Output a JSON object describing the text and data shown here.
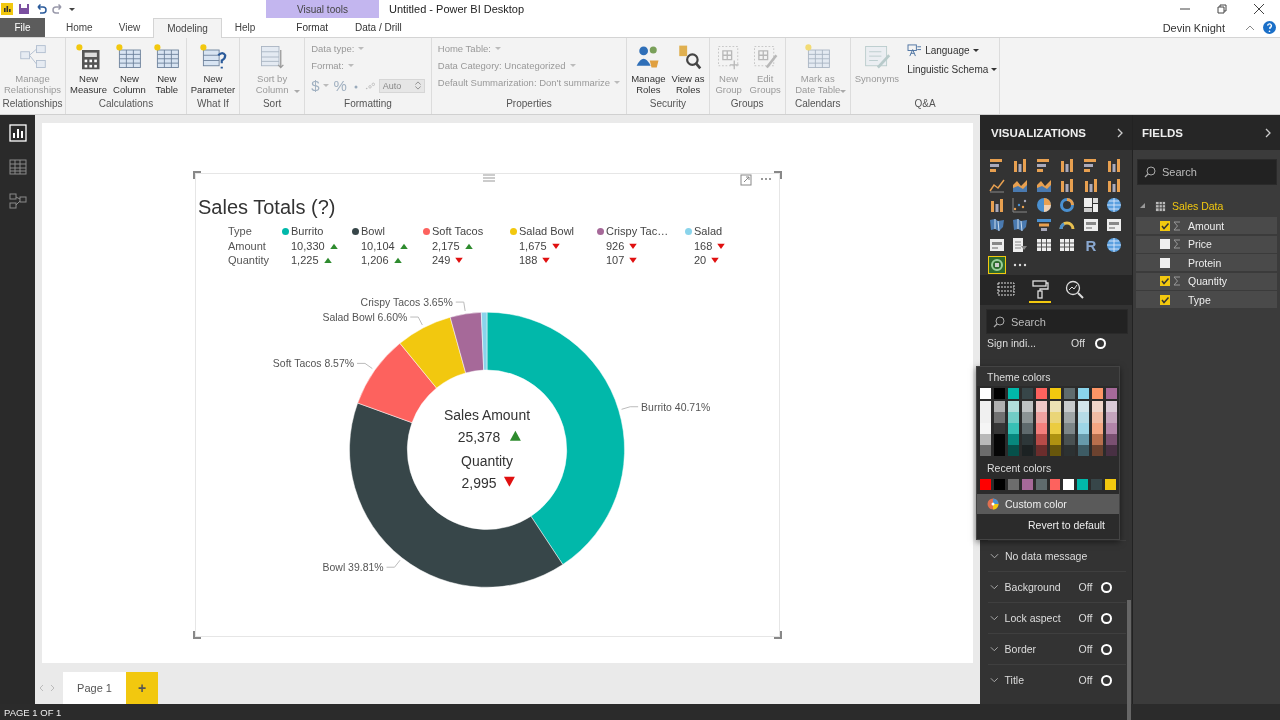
{
  "title_bar": {
    "title": "Untitled - Power BI Desktop",
    "context_label": "Visual tools"
  },
  "menu_tabs": [
    {
      "label": "File",
      "kind": "file",
      "selected": false
    },
    {
      "label": "Home",
      "kind": "main",
      "selected": false
    },
    {
      "label": "View",
      "kind": "main",
      "selected": false
    },
    {
      "label": "Modeling",
      "kind": "main",
      "selected": true
    },
    {
      "label": "Help",
      "kind": "main",
      "selected": false
    },
    {
      "label": "Format",
      "kind": "context",
      "selected": false
    },
    {
      "label": "Data / Drill",
      "kind": "context",
      "selected": false
    }
  ],
  "user": "Devin Knight",
  "ribbon": [
    {
      "label": "Relationships",
      "kind": "buttons",
      "buttons": [
        {
          "kind": "relationships",
          "label": "Manage\nRelationships",
          "disabled": true,
          "dropdown": false
        }
      ]
    },
    {
      "label": "Calculations",
      "kind": "buttons",
      "buttons": [
        {
          "kind": "calculator",
          "label": "New\nMeasure",
          "disabled": false,
          "dropdown": false
        },
        {
          "kind": "new-table",
          "label": "New\nColumn",
          "disabled": false,
          "dropdown": false
        },
        {
          "kind": "new-table",
          "label": "New\nTable",
          "disabled": false,
          "dropdown": false
        }
      ]
    },
    {
      "label": "What If",
      "kind": "buttons",
      "buttons": [
        {
          "kind": "parameter",
          "label": "New\nParameter",
          "disabled": false,
          "dropdown": false
        }
      ]
    },
    {
      "label": "Sort",
      "kind": "buttons",
      "buttons": [
        {
          "kind": "sort",
          "label": "Sort by\nColumn",
          "disabled": true,
          "dropdown": true
        }
      ]
    },
    {
      "label": "Formatting",
      "kind": "formatting",
      "fields": [
        {
          "label": "Data type:",
          "disabled": true
        },
        {
          "label": "Format:",
          "disabled": true
        }
      ],
      "currency": "$",
      "percent": "%",
      "decimals": "Auto",
      "disabled": true
    },
    {
      "label": "Properties",
      "kind": "properties",
      "fields": [
        {
          "label": "Home Table:",
          "disabled": true
        },
        {
          "label": "Data Category: Uncategorized",
          "disabled": true
        },
        {
          "label": "Default Summarization: Don't summarize",
          "disabled": true
        }
      ]
    },
    {
      "label": "Security",
      "kind": "buttons",
      "buttons": [
        {
          "kind": "roles",
          "label": "Manage\nRoles",
          "disabled": false,
          "dropdown": false
        },
        {
          "kind": "view-roles",
          "label": "View as\nRoles",
          "disabled": false,
          "dropdown": false
        }
      ]
    },
    {
      "label": "Groups",
      "kind": "buttons",
      "buttons": [
        {
          "kind": "new-group",
          "label": "New\nGroup",
          "disabled": true,
          "dropdown": false
        },
        {
          "kind": "edit-group",
          "label": "Edit\nGroups",
          "disabled": true,
          "dropdown": false
        }
      ]
    },
    {
      "label": "Calendars",
      "kind": "buttons",
      "buttons": [
        {
          "kind": "date-table",
          "label": "Mark as\nDate Table",
          "disabled": true,
          "dropdown": true
        }
      ]
    },
    {
      "label": "Q&A",
      "kind": "qa",
      "buttons": [
        {
          "kind": "synonyms",
          "label": "Synonyms",
          "disabled": true,
          "dropdown": false
        }
      ],
      "menus": [
        {
          "label": "Language",
          "kind": "language"
        },
        {
          "label": "Linguistic Schema",
          "kind": "plain"
        }
      ]
    }
  ],
  "views": [
    {
      "kind": "report",
      "selected": true
    },
    {
      "kind": "data",
      "selected": false
    },
    {
      "kind": "model",
      "selected": false
    }
  ],
  "visual": {
    "title": "Sales Totals (?)",
    "row_labels": [
      "Type",
      "Amount",
      "Quantity"
    ],
    "legend": [
      {
        "name": "Burrito",
        "color": "#01b8aa",
        "amount": "10,330",
        "amount_up": true,
        "quantity": "1,225",
        "quantity_up": true
      },
      {
        "name": "Bowl",
        "color": "#374649",
        "amount": "10,104",
        "amount_up": true,
        "quantity": "1,206",
        "quantity_up": true
      },
      {
        "name": "Soft Tacos",
        "color": "#fd625e",
        "amount": "2,175",
        "amount_up": true,
        "quantity": "249",
        "quantity_up": false
      },
      {
        "name": "Salad Bowl",
        "color": "#f2c80f",
        "amount": "1,675",
        "amount_up": false,
        "quantity": "188",
        "quantity_up": false
      },
      {
        "name": "Crispy Tac…",
        "color": "#a66999",
        "amount": "926",
        "amount_up": false,
        "quantity": "107",
        "quantity_up": false
      },
      {
        "name": "Salad",
        "color": "#8ad4eb",
        "amount": "168",
        "amount_up": false,
        "quantity": "20",
        "quantity_up": false
      }
    ],
    "center": {
      "label_1": "Sales Amount",
      "value_1": "25,378",
      "up_1": true,
      "label_2": "Quantity",
      "value_2": "2,995",
      "up_2": false
    },
    "chart_data": {
      "type": "donut",
      "values": [
        40.71,
        39.81,
        8.57,
        6.6,
        3.65,
        0.66
      ],
      "value_labels": [
        "Burrito 40.71%",
        "Bowl 39.81%",
        "Soft Tacos 8.57%",
        "Salad Bowl 6.60%",
        "Crispy Tacos 3.65%",
        null
      ]
    }
  },
  "pages": [
    {
      "label": "Page 1",
      "selected": true
    }
  ],
  "add_page": "+",
  "status": "PAGE 1 OF 1",
  "visualizations": {
    "title": "VISUALIZATIONS",
    "types": [
      {
        "kind": "hbar",
        "selected": false
      },
      {
        "kind": "vbar",
        "selected": false
      },
      {
        "kind": "hbar",
        "selected": false
      },
      {
        "kind": "vbar",
        "selected": false
      },
      {
        "kind": "hbar",
        "selected": false
      },
      {
        "kind": "vbar",
        "selected": false
      },
      {
        "kind": "line",
        "selected": false
      },
      {
        "kind": "area",
        "selected": false
      },
      {
        "kind": "area",
        "selected": false
      },
      {
        "kind": "vbar",
        "selected": false
      },
      {
        "kind": "vbar",
        "selected": false
      },
      {
        "kind": "vbar",
        "selected": false
      },
      {
        "kind": "vbar",
        "selected": false
      },
      {
        "kind": "scatter",
        "selected": false
      },
      {
        "kind": "pie",
        "selected": false
      },
      {
        "kind": "donut",
        "selected": false
      },
      {
        "kind": "treemap",
        "selected": false
      },
      {
        "kind": "globe",
        "selected": false
      },
      {
        "kind": "map",
        "selected": false
      },
      {
        "kind": "map",
        "selected": false
      },
      {
        "kind": "funnel",
        "selected": false
      },
      {
        "kind": "gauge",
        "selected": false
      },
      {
        "kind": "card",
        "selected": false
      },
      {
        "kind": "card",
        "selected": false
      },
      {
        "kind": "card",
        "selected": false
      },
      {
        "kind": "slicer",
        "selected": false
      },
      {
        "kind": "table",
        "selected": false
      },
      {
        "kind": "table",
        "selected": false
      },
      {
        "kind": "glyph",
        "glyph": "R",
        "selected": false
      },
      {
        "kind": "globe",
        "selected": false
      },
      {
        "kind": "custom",
        "selected": true
      },
      {
        "kind": "more",
        "selected": false
      }
    ],
    "pane_tabs": [
      {
        "kind": "fields",
        "selected": false
      },
      {
        "kind": "format",
        "selected": true
      },
      {
        "kind": "analytics",
        "selected": false
      }
    ],
    "search": {
      "placeholder": "Search"
    },
    "sign_indicator": {
      "label": "Sign indi...",
      "state": "Off",
      "on": false
    },
    "color_picker": {
      "theme_title": "Theme colors",
      "theme_colors": [
        {
          "color": "#ffffff"
        },
        {
          "color": "#000000"
        },
        {
          "color": "#01b8aa"
        },
        {
          "color": "#374649"
        },
        {
          "color": "#fd625e"
        },
        {
          "color": "#f2c80f"
        },
        {
          "color": "#5f6b6d"
        },
        {
          "color": "#8ad4eb"
        },
        {
          "color": "#fe9666"
        },
        {
          "color": "#a66999"
        }
      ],
      "recent_title": "Recent colors",
      "recent_colors": [
        {
          "color": "#ff0000"
        },
        {
          "color": "#000000"
        },
        {
          "color": "#6d6d6d"
        },
        {
          "color": "#a66999"
        },
        {
          "color": "#5f6b6d"
        },
        {
          "color": "#fd625e"
        },
        {
          "color": "#ffffff"
        },
        {
          "color": "#01b8aa"
        },
        {
          "color": "#374649"
        },
        {
          "color": "#f2c80f"
        }
      ],
      "custom": "Custom color",
      "revert": "Revert to default"
    },
    "sections": [
      {
        "label": "No data message",
        "kind": "plain"
      },
      {
        "label": "Background",
        "kind": "toggle",
        "state": "Off",
        "on": false
      },
      {
        "label": "Lock aspect",
        "kind": "toggle",
        "state": "Off",
        "on": false
      },
      {
        "label": "Border",
        "kind": "toggle",
        "state": "Off",
        "on": false
      },
      {
        "label": "Title",
        "kind": "toggle",
        "state": "Off",
        "on": false
      }
    ]
  },
  "fields": {
    "title": "FIELDS",
    "search": {
      "placeholder": "Search"
    },
    "tables": [
      {
        "name": "Sales Data",
        "expanded": true,
        "fields": [
          {
            "name": "Amount",
            "kind": "measure",
            "checked": true
          },
          {
            "name": "Price",
            "kind": "measure",
            "checked": false
          },
          {
            "name": "Protein",
            "kind": "text",
            "checked": false
          },
          {
            "name": "Quantity",
            "kind": "measure",
            "checked": true
          },
          {
            "name": "Type",
            "kind": "text",
            "checked": true
          }
        ]
      }
    ]
  }
}
